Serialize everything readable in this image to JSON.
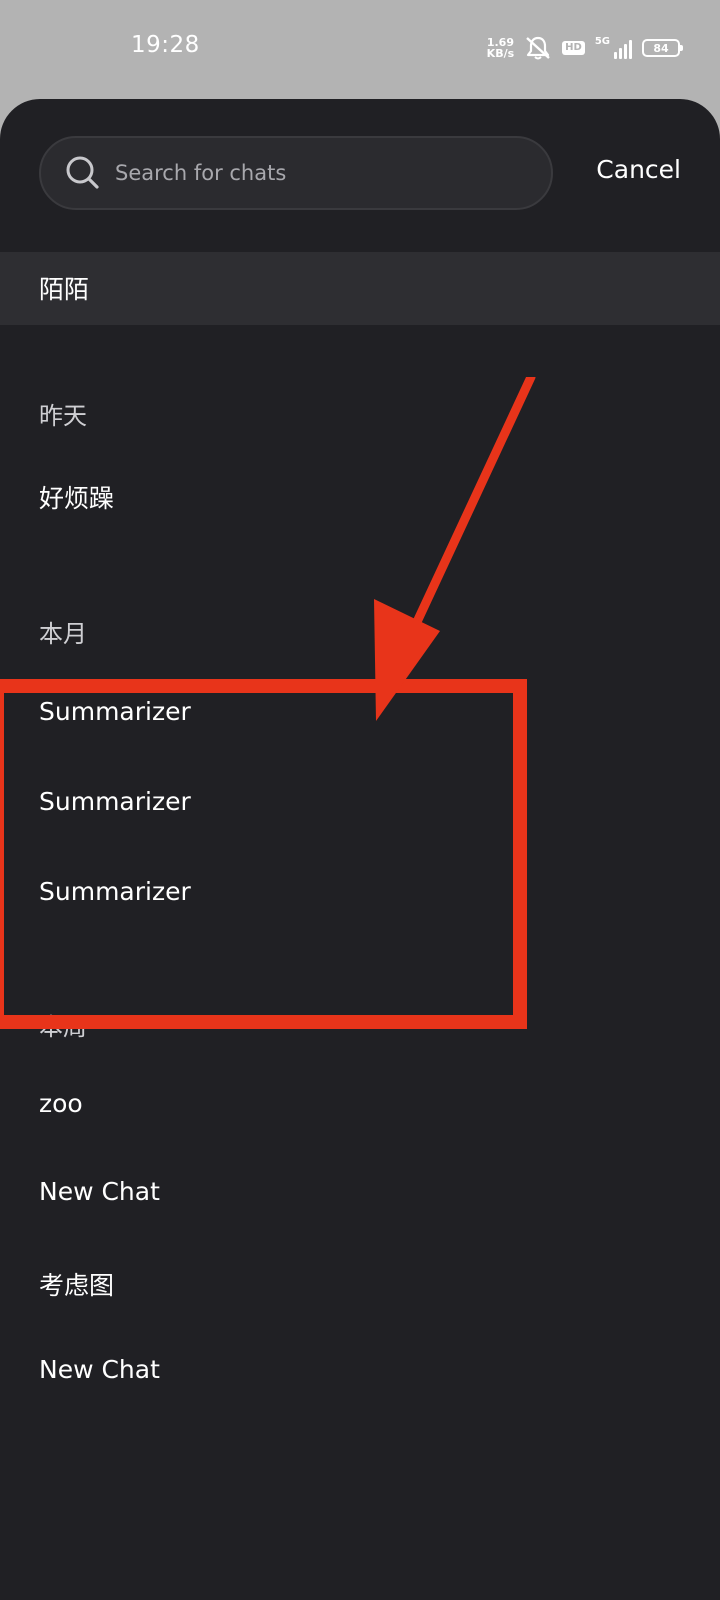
{
  "status_bar": {
    "time": "19:28",
    "net_speed_value": "1.69",
    "net_speed_unit": "KB/s",
    "hd_label": "HD",
    "network_label": "5G",
    "battery": "84"
  },
  "search": {
    "placeholder": "Search for chats",
    "cancel_label": "Cancel"
  },
  "pinned": {
    "label": "陌陌"
  },
  "groups": [
    {
      "title": "昨天",
      "items": [
        "好烦躁"
      ]
    },
    {
      "title": "本月",
      "items": [
        "Summarizer",
        "Summarizer",
        "Summarizer"
      ]
    },
    {
      "title": "本周",
      "items": [
        "zoo",
        "New Chat",
        "考虑图",
        "New Chat"
      ]
    }
  ],
  "annotation_color": "#e8341a"
}
